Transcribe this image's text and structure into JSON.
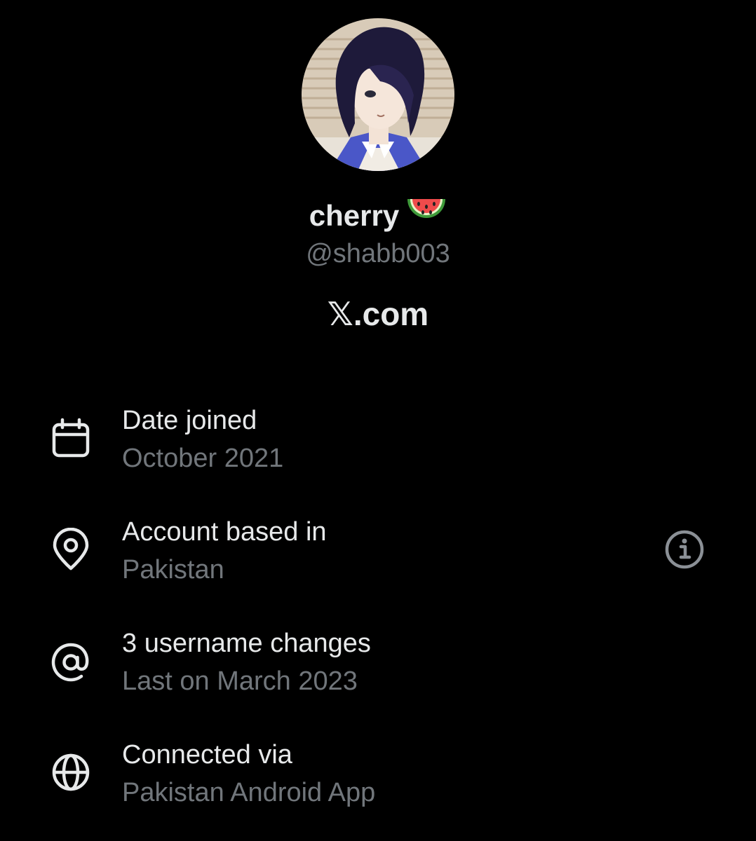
{
  "profile": {
    "display_name": "cherry",
    "name_emoji": "watermelon-emoji",
    "handle": "@shabb003",
    "site_label": "𝕏.com"
  },
  "details": [
    {
      "icon": "calendar-icon",
      "label": "Date joined",
      "value": "October 2021"
    },
    {
      "icon": "location-pin-icon",
      "label": "Account based in",
      "value": "Pakistan"
    },
    {
      "icon": "at-sign-icon",
      "label": "3 username changes",
      "value": "Last on March 2023"
    },
    {
      "icon": "globe-icon",
      "label": "Connected via",
      "value": "Pakistan Android App"
    }
  ],
  "colors": {
    "background": "#000000",
    "primary_text": "#e7e9ea",
    "secondary_text": "#71767b"
  }
}
